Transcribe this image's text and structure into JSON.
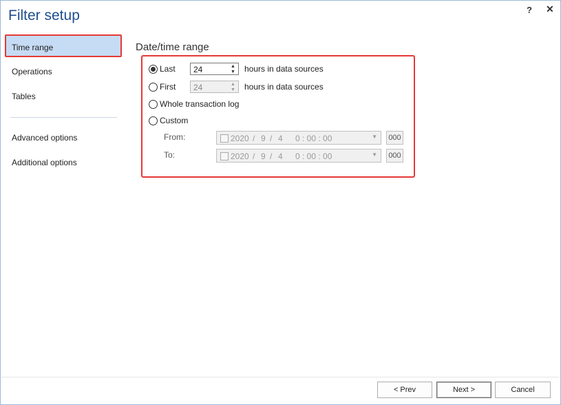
{
  "window": {
    "title": "Filter setup",
    "help_label": "?",
    "close_label": "✕"
  },
  "sidebar": {
    "items": [
      {
        "label": "Time range"
      },
      {
        "label": "Operations"
      },
      {
        "label": "Tables"
      },
      {
        "label": "Advanced options"
      },
      {
        "label": "Additional options"
      }
    ],
    "selected": "Time range"
  },
  "section": {
    "title": "Date/time range"
  },
  "options": {
    "last": {
      "label": "Last",
      "value": "24",
      "suffix": "hours in data sources",
      "selected": true
    },
    "first": {
      "label": "First",
      "value": "24",
      "suffix": "hours in data sources",
      "selected": false,
      "disabled": true
    },
    "whole": {
      "label": "Whole transaction log",
      "selected": false
    },
    "custom": {
      "label": "Custom",
      "selected": false
    }
  },
  "range": {
    "from": {
      "label": "From:",
      "year": "2020",
      "month": "9",
      "day": "4",
      "time": "0 : 00 : 00",
      "ms": "000"
    },
    "to": {
      "label": "To:",
      "year": "2020",
      "month": "9",
      "day": "4",
      "time": "0 : 00 : 00",
      "ms": "000"
    },
    "separator": "/"
  },
  "buttons": {
    "prev": "< Prev",
    "next": "Next >",
    "cancel": "Cancel"
  },
  "colors": {
    "highlight": "#e53935",
    "selected_bg": "#c6dbf4",
    "title": "#1f4e8c"
  }
}
